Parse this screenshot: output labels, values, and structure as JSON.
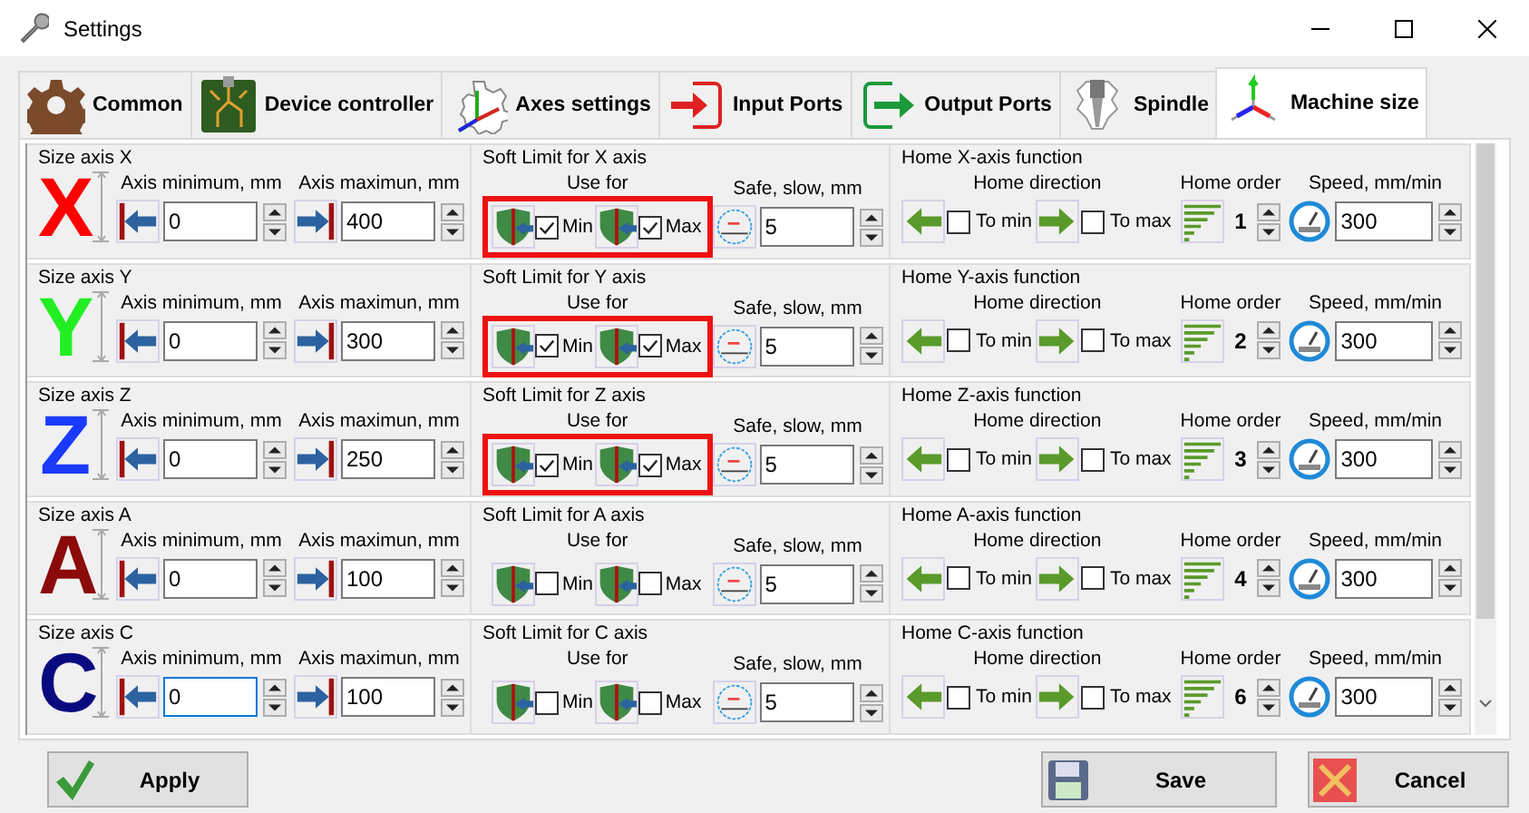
{
  "window": {
    "title": "Settings"
  },
  "tabs": [
    {
      "label": "Common",
      "kind": "gear",
      "selected": false
    },
    {
      "label": "Device controller",
      "kind": "board",
      "selected": false
    },
    {
      "label": "Axes settings",
      "kind": "axes",
      "selected": false
    },
    {
      "label": "Input Ports",
      "kind": "input",
      "selected": false
    },
    {
      "label": "Output Ports",
      "kind": "output",
      "selected": false
    },
    {
      "label": "Spindle",
      "kind": "spindle",
      "selected": false
    },
    {
      "label": "Machine size",
      "kind": "machine",
      "selected": true
    }
  ],
  "axes": [
    {
      "letter": "X",
      "color": "#ff0000",
      "size_title": "Size axis X",
      "min_label": "Axis minimum, mm",
      "min_value": "0",
      "min_focused": false,
      "max_label": "Axis maximun, mm",
      "max_value": "400",
      "soft_title": "Soft Limit for X axis",
      "use_for": "Use for",
      "highlighted": true,
      "min_check": "Min",
      "min_checked": true,
      "max_check": "Max",
      "max_checked": true,
      "safe_label": "Safe, slow, mm",
      "safe_value": "5",
      "home_title": "Home X-axis function",
      "home_direction": "Home direction",
      "to_min": "To min",
      "to_min_checked": false,
      "to_max": "To max",
      "to_max_checked": false,
      "order_label": "Home order",
      "order_value": "1",
      "speed_label": "Speed, mm/min",
      "speed_value": "300"
    },
    {
      "letter": "Y",
      "color": "#22ee22",
      "size_title": "Size axis Y",
      "min_label": "Axis minimum, mm",
      "min_value": "0",
      "min_focused": false,
      "max_label": "Axis maximun, mm",
      "max_value": "300",
      "soft_title": "Soft Limit for Y axis",
      "use_for": "Use for",
      "highlighted": true,
      "min_check": "Min",
      "min_checked": true,
      "max_check": "Max",
      "max_checked": true,
      "safe_label": "Safe, slow, mm",
      "safe_value": "5",
      "home_title": "Home Y-axis function",
      "home_direction": "Home direction",
      "to_min": "To min",
      "to_min_checked": false,
      "to_max": "To max",
      "to_max_checked": false,
      "order_label": "Home order",
      "order_value": "2",
      "speed_label": "Speed, mm/min",
      "speed_value": "300"
    },
    {
      "letter": "Z",
      "color": "#1a3bff",
      "size_title": "Size axis Z",
      "min_label": "Axis minimum, mm",
      "min_value": "0",
      "min_focused": false,
      "max_label": "Axis maximun, mm",
      "max_value": "250",
      "soft_title": "Soft Limit for Z axis",
      "use_for": "Use for",
      "highlighted": true,
      "min_check": "Min",
      "min_checked": true,
      "max_check": "Max",
      "max_checked": true,
      "safe_label": "Safe, slow, mm",
      "safe_value": "5",
      "home_title": "Home Z-axis function",
      "home_direction": "Home direction",
      "to_min": "To min",
      "to_min_checked": false,
      "to_max": "To max",
      "to_max_checked": false,
      "order_label": "Home order",
      "order_value": "3",
      "speed_label": "Speed, mm/min",
      "speed_value": "300"
    },
    {
      "letter": "A",
      "color": "#8b0a0a",
      "size_title": "Size axis A",
      "min_label": "Axis minimum, mm",
      "min_value": "0",
      "min_focused": false,
      "max_label": "Axis maximun, mm",
      "max_value": "100",
      "soft_title": "Soft Limit for A axis",
      "use_for": "Use for",
      "highlighted": false,
      "min_check": "Min",
      "min_checked": false,
      "max_check": "Max",
      "max_checked": false,
      "safe_label": "Safe, slow, mm",
      "safe_value": "5",
      "home_title": "Home A-axis function",
      "home_direction": "Home direction",
      "to_min": "To min",
      "to_min_checked": false,
      "to_max": "To max",
      "to_max_checked": false,
      "order_label": "Home order",
      "order_value": "4",
      "speed_label": "Speed, mm/min",
      "speed_value": "300"
    },
    {
      "letter": "C",
      "color": "#0a0a80",
      "size_title": "Size axis C",
      "min_label": "Axis minimum, mm",
      "min_value": "0",
      "min_focused": true,
      "max_label": "Axis maximun, mm",
      "max_value": "100",
      "soft_title": "Soft Limit for C axis",
      "use_for": "Use for",
      "highlighted": false,
      "min_check": "Min",
      "min_checked": false,
      "max_check": "Max",
      "max_checked": false,
      "safe_label": "Safe, slow, mm",
      "safe_value": "5",
      "home_title": "Home C-axis function",
      "home_direction": "Home direction",
      "to_min": "To min",
      "to_min_checked": false,
      "to_max": "To max",
      "to_max_checked": false,
      "order_label": "Home order",
      "order_value": "6",
      "speed_label": "Speed, mm/min",
      "speed_value": "300"
    }
  ],
  "buttons": [
    {
      "label": "Apply",
      "kind": "apply"
    },
    {
      "label": "Save",
      "kind": "save"
    },
    {
      "label": "Cancel",
      "kind": "cancel"
    }
  ]
}
